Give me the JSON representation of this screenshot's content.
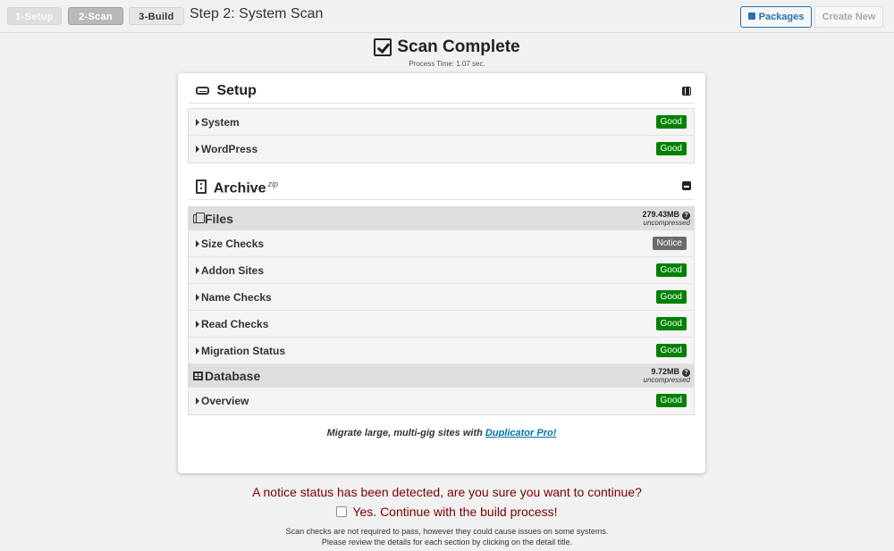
{
  "steps": {
    "step1": "1-Setup",
    "step2": "2-Scan",
    "step3": "3-Build",
    "title": "Step 2: System Scan"
  },
  "toolbar": {
    "packages": "Packages",
    "create_new": "Create New"
  },
  "header": {
    "title": "Scan Complete",
    "process_time": "Process Time: 1.07 sec."
  },
  "setup": {
    "title": "Setup",
    "rows": [
      {
        "label": "System",
        "status": "Good"
      },
      {
        "label": "WordPress",
        "status": "Good"
      }
    ]
  },
  "archive": {
    "title": "Archive",
    "format": "zip",
    "files": {
      "title": "Files",
      "size": "279.43MB",
      "size_note": "uncompressed",
      "rows": [
        {
          "label": "Size Checks",
          "status": "Notice"
        },
        {
          "label": "Addon Sites",
          "status": "Good"
        },
        {
          "label": "Name Checks",
          "status": "Good"
        },
        {
          "label": "Read Checks",
          "status": "Good"
        },
        {
          "label": "Migration Status",
          "status": "Good"
        }
      ]
    },
    "database": {
      "title": "Database",
      "size": "9.72MB",
      "size_note": "uncompressed",
      "rows": [
        {
          "label": "Overview",
          "status": "Good"
        }
      ]
    }
  },
  "promo": {
    "text": "Migrate large, multi-gig sites with",
    "link": "Duplicator Pro!"
  },
  "notice": {
    "message": "A notice status has been detected, are you sure you want to continue?",
    "confirm_label": "Yes. Continue with the build process!",
    "note_line1": "Scan checks are not required to pass, however they could cause issues on some systems.",
    "note_line2": "Please review the details for each section by clicking on the detail title."
  },
  "colors": {
    "good": "#008000",
    "notice": "#6b6b6b",
    "link": "#0073aa",
    "warning_text": "#7a0000"
  }
}
